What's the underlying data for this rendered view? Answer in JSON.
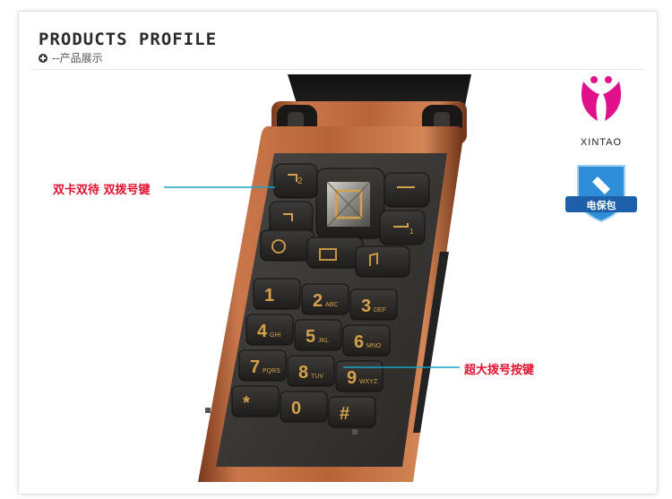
{
  "section": {
    "title": "PRODUCTS PROFILE",
    "subtitle": "--产品展示"
  },
  "callouts": {
    "dual_sim": "双卡双待 双拨号键",
    "big_keys": "超大拨号按键"
  },
  "brand": {
    "name": "XINTAO",
    "badge_text": "电保包"
  },
  "keypad": [
    {
      "digit": "1",
      "letters": ""
    },
    {
      "digit": "2",
      "letters": "ABC"
    },
    {
      "digit": "3",
      "letters": "DEF"
    },
    {
      "digit": "4",
      "letters": "GHI"
    },
    {
      "digit": "5",
      "letters": "JKL"
    },
    {
      "digit": "6",
      "letters": "MNO"
    },
    {
      "digit": "7",
      "letters": "PQRS"
    },
    {
      "digit": "8",
      "letters": "TUV"
    },
    {
      "digit": "9",
      "letters": "WXYZ"
    },
    {
      "digit": "*",
      "letters": ""
    },
    {
      "digit": "0",
      "letters": ""
    },
    {
      "digit": "#",
      "letters": ""
    }
  ],
  "call_keys": {
    "sim1": "1",
    "sim2": "2"
  },
  "colors": {
    "accent_red": "#e0102f",
    "line_teal": "#1aa3c4",
    "phone_copper": "#b8643a",
    "key_gold": "#d4a24a",
    "logo_magenta": "#e0118a"
  }
}
